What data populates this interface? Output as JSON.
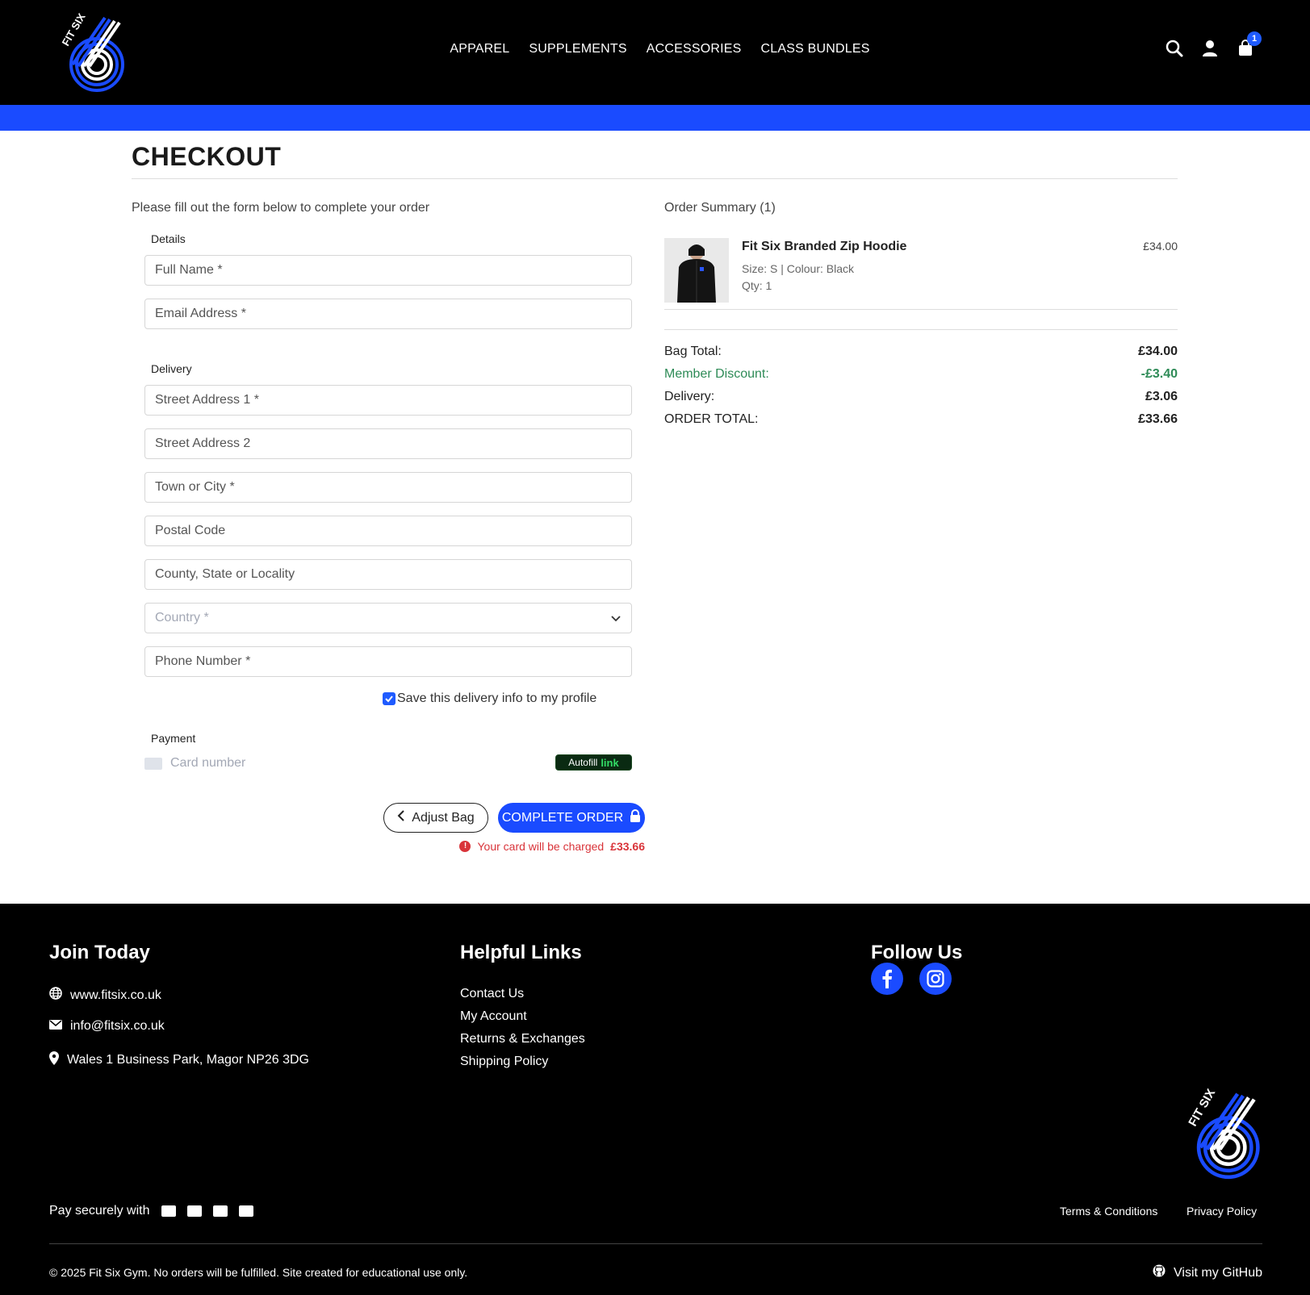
{
  "brand": {
    "logo_text": "FIT SIX",
    "accent_color": "#1a4bff"
  },
  "nav": {
    "items": [
      "APPAREL",
      "SUPPLEMENTS",
      "ACCESSORIES",
      "CLASS BUNDLES"
    ]
  },
  "header_icons": {
    "search": "search-icon",
    "account": "user-icon",
    "cart": "shopping-bag-icon",
    "cart_count": "1"
  },
  "checkout": {
    "title": "CHECKOUT",
    "intro": "Please fill out the form below to complete your order",
    "details_label": "Details",
    "delivery_label": "Delivery",
    "payment_label": "Payment",
    "fields": {
      "full_name": "Full Name *",
      "email": "Email Address *",
      "street1": "Street Address 1 *",
      "street2": "Street Address 2",
      "town": "Town or City *",
      "postal": "Postal Code",
      "county": "County, State or Locality",
      "country": "Country *",
      "phone": "Phone Number *"
    },
    "save_info": {
      "label": "Save this delivery info to my profile",
      "checked": true
    },
    "card_placeholder": "Card number",
    "autofill": {
      "label": "Autofill",
      "brand": "link"
    },
    "adjust_bag": "Adjust Bag",
    "complete_order": "COMPLETE ORDER",
    "charge_note": {
      "prefix": "Your card will be charged",
      "amount": "£33.66"
    }
  },
  "summary": {
    "title": "Order Summary (1)",
    "item": {
      "name": "Fit Six Branded Zip Hoodie",
      "price": "£34.00",
      "meta": "Size: S | Colour: Black",
      "qty": "Qty: 1"
    },
    "totals": {
      "bag_label": "Bag Total:",
      "bag_value": "£34.00",
      "discount_label": "Member Discount:",
      "discount_value": "-£3.40",
      "delivery_label": "Delivery:",
      "delivery_value": "£3.06",
      "order_label": "ORDER TOTAL:",
      "order_value": "£33.66"
    },
    "discount_color": "#2e8b57"
  },
  "footer": {
    "join": {
      "heading": "Join Today",
      "website": "www.fitsix.co.uk",
      "email": "info@fitsix.co.uk",
      "address": "Wales 1 Business Park, Magor NP26 3DG"
    },
    "links": {
      "heading": "Helpful Links",
      "items": [
        "Contact Us",
        "My Account",
        "Returns & Exchanges",
        "Shipping Policy"
      ]
    },
    "follow": {
      "heading": "Follow Us",
      "icons": [
        "facebook-icon",
        "instagram-icon"
      ]
    },
    "pay": "Pay securely with",
    "terms": "Terms & Conditions",
    "privacy": "Privacy Policy",
    "copyright": "© 2025 Fit Six Gym. No orders will be fulfilled. Site created for educational use only.",
    "github": "Visit my GitHub"
  }
}
